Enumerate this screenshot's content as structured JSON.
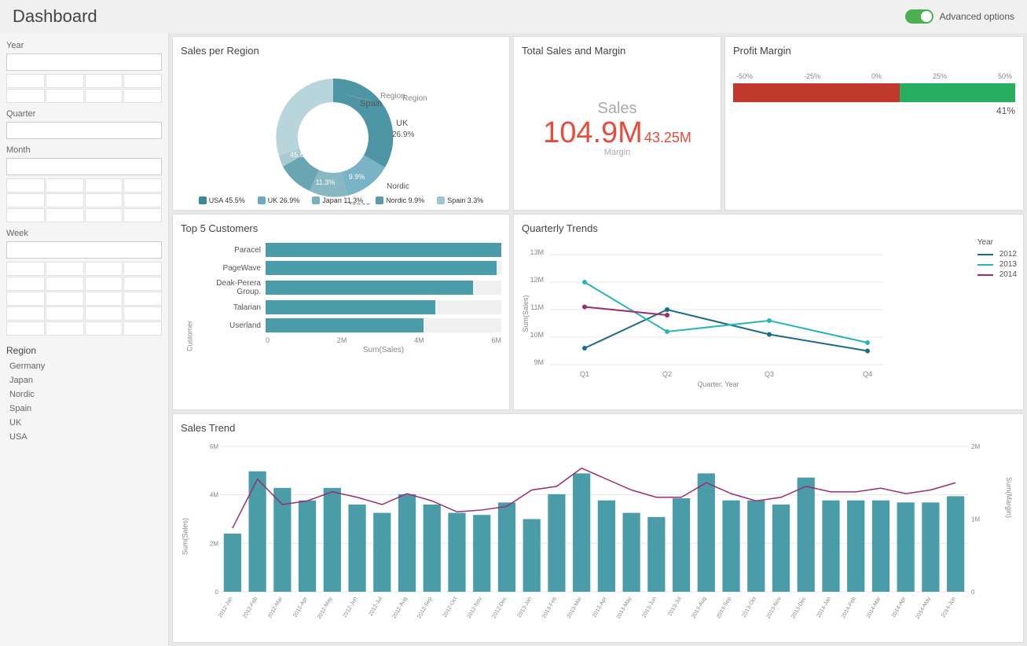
{
  "header": {
    "title": "Dashboard",
    "advanced_options_label": "Advanced options"
  },
  "sidebar": {
    "filters": [
      {
        "label": "Year",
        "value": ""
      },
      {
        "label": "Quarter",
        "value": ""
      },
      {
        "label": "Month",
        "value": ""
      },
      {
        "label": "Week",
        "value": ""
      }
    ],
    "region_section": "Region",
    "regions": [
      "Germany",
      "Japan",
      "Nordic",
      "Spain",
      "UK",
      "USA"
    ]
  },
  "sales_per_region": {
    "title": "Sales per Region",
    "segments": [
      {
        "label": "UK",
        "pct": 26.9,
        "color": "#6baac0"
      },
      {
        "label": "Nordic",
        "pct": 9.9,
        "color": "#5a9caa"
      },
      {
        "label": "Japan",
        "pct": 11.3,
        "color": "#7ab0bd"
      },
      {
        "label": "USA",
        "pct": 45.5,
        "color": "#3a8a9a"
      },
      {
        "label": "Spain",
        "pct": 3.3,
        "color": "#a0c4cc"
      },
      {
        "label": "Region",
        "pct": 3.1,
        "color": "#b0d0d8"
      }
    ]
  },
  "total_sales": {
    "title": "Total Sales and Margin",
    "sales_label": "Sales",
    "sales_value": "104.9M",
    "margin_value": "43.25M",
    "margin_label": "Margin"
  },
  "profit_margin": {
    "title": "Profit Margin",
    "axis_labels": [
      "-50%",
      "-25%",
      "0%",
      "25%",
      "50%"
    ],
    "red_pct": 59,
    "green_pct": 41,
    "percentage_label": "41%"
  },
  "top5_customers": {
    "title": "Top 5 Customers",
    "customers": [
      {
        "name": "Paracel",
        "value": 6000000,
        "pct": 100
      },
      {
        "name": "PageWave",
        "value": 5900000,
        "pct": 98
      },
      {
        "name": "Deak-Perera Group.",
        "value": 5300000,
        "pct": 88
      },
      {
        "name": "Talarian",
        "value": 4300000,
        "pct": 72
      },
      {
        "name": "Userland",
        "value": 4000000,
        "pct": 67
      }
    ],
    "x_axis_labels": [
      "0",
      "2M",
      "4M",
      "6M"
    ],
    "x_label": "Sum(Sales)",
    "y_label": "Customer"
  },
  "quarterly_trends": {
    "title": "Quarterly Trends",
    "y_axis": [
      "9M",
      "10M",
      "11M",
      "12M",
      "13M"
    ],
    "x_axis": [
      "Q1",
      "Q2",
      "Q3",
      "Q4"
    ],
    "y_label": "Sum(Sales)",
    "x_label": "Quarter, Year",
    "legend_title": "Year",
    "series": [
      {
        "year": "2012",
        "color": "#1a6b8a",
        "points": [
          9.6,
          11.0,
          10.1,
          9.5
        ]
      },
      {
        "year": "2013",
        "color": "#2ab5b5",
        "points": [
          12.0,
          10.2,
          10.6,
          9.8
        ]
      },
      {
        "year": "2014",
        "color": "#9b2d6e",
        "points": [
          11.1,
          10.8,
          null,
          null
        ]
      }
    ]
  },
  "sales_trend": {
    "title": "Sales Trend",
    "y_label_left": "Sum(Sales)",
    "y_label_right": "Sum(Margin)",
    "y_left_max": "6M",
    "y_right_max": "2M",
    "bar_color": "#4a9da8",
    "line_color": "#9b2d6e",
    "months": [
      "2012-Jan",
      "2012-Feb",
      "2012-Mar",
      "2012-Apr",
      "2012-May",
      "2012-Jun",
      "2012-Jul",
      "2012-Aug",
      "2012-Sep",
      "2012-Oct",
      "2012-Nov",
      "2012-Dec",
      "2013-Jan",
      "2013-Feb",
      "2013-Mar",
      "2013-Apr",
      "2013-May",
      "2013-Jun",
      "2013-Jul",
      "2013-Aug",
      "2013-Sep",
      "2013-Oct",
      "2013-Nov",
      "2013-Dec",
      "2014-Jan",
      "2014-Feb",
      "2014-Mar",
      "2014-Apr",
      "2014-May",
      "2014-Jun"
    ],
    "bar_values": [
      28,
      58,
      50,
      44,
      50,
      42,
      38,
      47,
      42,
      38,
      37,
      43,
      35,
      47,
      57,
      44,
      38,
      36,
      45,
      57,
      44,
      44,
      42,
      55,
      44,
      44,
      44,
      43,
      43,
      46
    ],
    "line_values": [
      35,
      62,
      48,
      50,
      55,
      52,
      48,
      54,
      50,
      44,
      45,
      47,
      56,
      58,
      68,
      62,
      56,
      52,
      52,
      60,
      54,
      50,
      52,
      58,
      55,
      55,
      57,
      54,
      56,
      60
    ]
  }
}
